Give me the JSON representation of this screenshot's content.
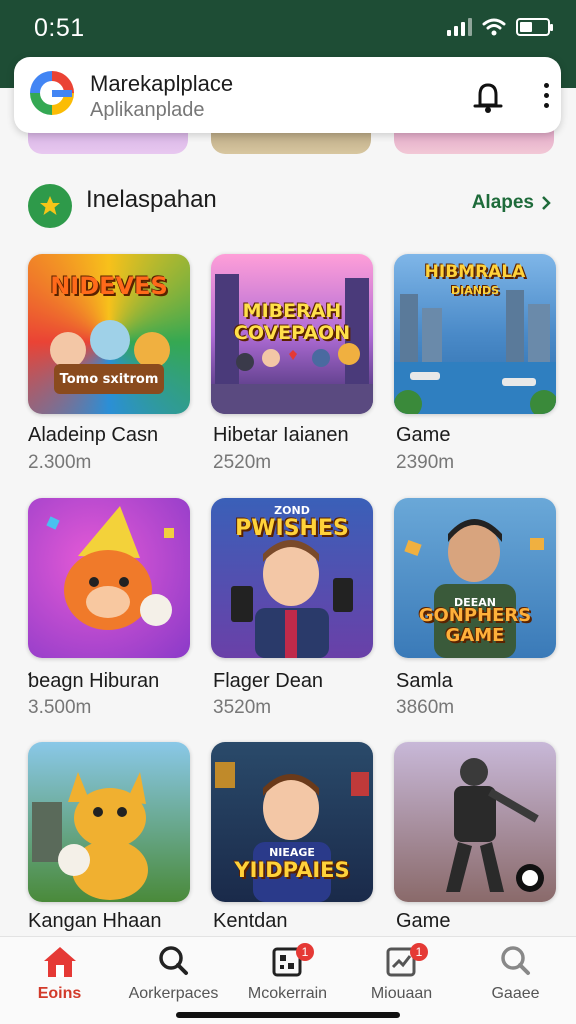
{
  "status_bar": {
    "time": "0:51"
  },
  "header": {
    "title": "Marekaplplace",
    "subtitle": "Aplikanplade"
  },
  "section": {
    "title": "Inelaspahan",
    "see_all": "Alapes"
  },
  "apps": [
    {
      "name": "Aladeinp Casn",
      "size": "2.300m",
      "art_title": "NIDEVES",
      "art_sub": "Tomo sxitrom",
      "icon": "kids-party-art"
    },
    {
      "name": "Hibetar Iaianen",
      "size": "2520m",
      "art_title": "MIBERAH COVEPAON",
      "art_sub": "",
      "icon": "city-heroes-art"
    },
    {
      "name": "Game",
      "size": "2390m",
      "art_title": "HIBMRALA",
      "art_sub": "DIANDS",
      "icon": "harbor-city-art"
    },
    {
      "name": "ƅeagn Hiburan",
      "size": "3.500m",
      "art_title": "",
      "art_sub": "",
      "icon": "party-bear-art"
    },
    {
      "name": "Flager Dean",
      "size": "3520m",
      "art_title": "PWISHES",
      "art_sub": "ZOND",
      "icon": "phone-boy-art"
    },
    {
      "name": "Samla",
      "size": "3860m",
      "art_title": "GONPHERS GAME",
      "art_sub": "DEEAN",
      "icon": "gamer-man-art"
    },
    {
      "name": "Kangan Hhaan",
      "size": "",
      "art_title": "",
      "art_sub": "",
      "icon": "cartoon-fox-art"
    },
    {
      "name": "Kentdan",
      "size": "",
      "art_title": "YIIDPAIES",
      "art_sub": "NIEAGE",
      "icon": "boy-portrait-art"
    },
    {
      "name": "Game",
      "size": "",
      "art_title": "",
      "art_sub": "",
      "icon": "soldier-art"
    }
  ],
  "bottom_nav": [
    {
      "label": "Eoins",
      "icon": "home-icon",
      "active": true,
      "badge": ""
    },
    {
      "label": "Aorkerpaces",
      "icon": "search-icon",
      "active": false,
      "badge": ""
    },
    {
      "label": "Mcokerrain",
      "icon": "qr-icon",
      "active": false,
      "badge": "1"
    },
    {
      "label": "Miouaan",
      "icon": "chart-icon",
      "active": false,
      "badge": "1"
    },
    {
      "label": "Gaaee",
      "icon": "search-outline-icon",
      "active": false,
      "badge": ""
    }
  ],
  "colors": {
    "status_bar": "#1e4d35",
    "accent": "#1e6b3a",
    "active_nav": "#d23a2a"
  }
}
